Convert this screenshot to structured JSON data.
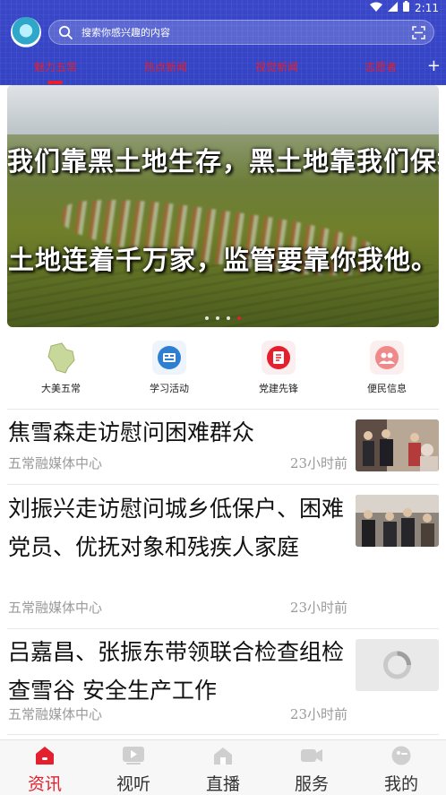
{
  "status_bar": {
    "time": "2:11",
    "icons": [
      "wifi-icon",
      "signal-icon",
      "battery-icon"
    ]
  },
  "header": {
    "search_placeholder": "搜索你感兴趣的内容",
    "tabs": [
      {
        "label": "魅力五常",
        "active": true
      },
      {
        "label": "热点新闻",
        "active": false
      },
      {
        "label": "视觉新闻",
        "active": false
      },
      {
        "label": "志愿者",
        "active": false
      }
    ],
    "accent_color": "#3344c4",
    "tab_color": "#e4202f"
  },
  "banner": {
    "lines": [
      "我们靠黑土地生存，黑土地靠我们保护。",
      "土地连着千万家，监管要靠你我他。"
    ],
    "slide_count": 4,
    "active_slide": 4
  },
  "quick_menu": [
    {
      "label": "大美五常",
      "icon": "map-icon"
    },
    {
      "label": "学习活动",
      "icon": "study-icon"
    },
    {
      "label": "党建先锋",
      "icon": "party-icon"
    },
    {
      "label": "便民信息",
      "icon": "people-icon"
    }
  ],
  "news": [
    {
      "title": "焦雪森走访慰问困难群众",
      "source": "五常融媒体中心",
      "time": "23小时前"
    },
    {
      "title": "刘振兴走访慰问城乡低保户、困难党员、优抚对象和残疾人家庭",
      "source": "五常融媒体中心",
      "time": "23小时前"
    },
    {
      "title": "吕嘉昌、张振东带领联合检查组检查雪谷 安全生产工作",
      "source": "五常融媒体中心",
      "time": "23小时前"
    }
  ],
  "bottom_nav": [
    {
      "label": "资讯",
      "icon": "news-icon",
      "active": true
    },
    {
      "label": "视听",
      "icon": "video-icon",
      "active": false
    },
    {
      "label": "直播",
      "icon": "live-icon",
      "active": false
    },
    {
      "label": "服务",
      "icon": "service-icon",
      "active": false
    },
    {
      "label": "我的",
      "icon": "profile-icon",
      "active": false
    }
  ]
}
